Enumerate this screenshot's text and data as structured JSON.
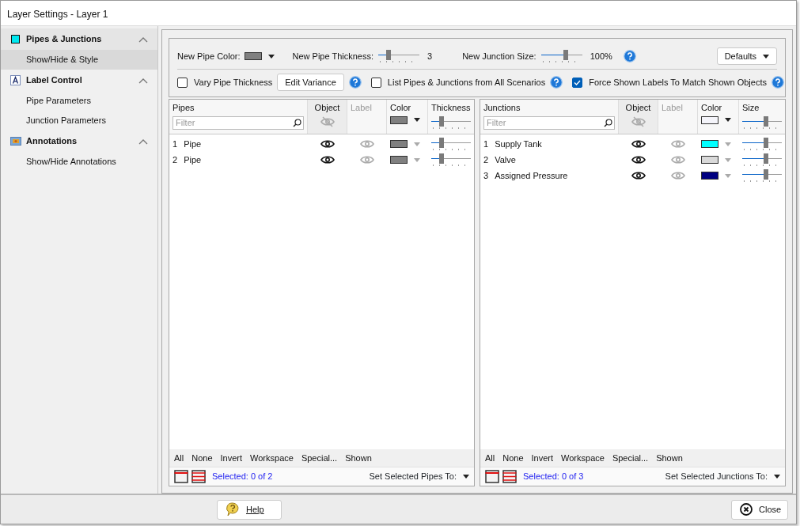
{
  "window": {
    "title": "Layer Settings - Layer 1"
  },
  "sidebar": {
    "groups": [
      {
        "label": "Pipes & Junctions",
        "expanded": true,
        "items": [
          {
            "label": "Show/Hide & Style",
            "selected": true
          }
        ]
      },
      {
        "label": "Label Control",
        "expanded": true,
        "items": [
          {
            "label": "Pipe Parameters",
            "selected": false
          },
          {
            "label": "Junction Parameters",
            "selected": false
          }
        ]
      },
      {
        "label": "Annotations",
        "expanded": true,
        "items": [
          {
            "label": "Show/Hide Annotations",
            "selected": false
          }
        ]
      }
    ]
  },
  "toolbar": {
    "pipe_color": {
      "label": "New Pipe Color:",
      "color": "#808080"
    },
    "pipe_thickness": {
      "label": "New Pipe Thickness:",
      "level": 0.25,
      "reading": "3"
    },
    "junction_size": {
      "label": "New Junction Size:",
      "level": 0.6,
      "reading": "100%"
    },
    "defaults_button": "Defaults",
    "vary_thickness": {
      "label": "Vary Pipe Thickness",
      "checked": false
    },
    "edit_variance_button": "Edit Variance",
    "list_all_scenarios": {
      "label": "List Pipes & Junctions from All Scenarios",
      "checked": false
    },
    "force_labels": {
      "label": "Force Shown Labels To Match Shown Objects",
      "checked": true
    }
  },
  "panels": [
    {
      "columns": [
        "Pipes",
        "Object",
        "Label",
        "Color",
        "Thickness"
      ],
      "filter_placeholder": "Filter",
      "header": {
        "color": "#808080",
        "level": 0.25
      },
      "rows": [
        {
          "number": "1",
          "name": "Pipe",
          "object_shown": true,
          "label_shown": false,
          "color": "#808080",
          "level": 0.25
        },
        {
          "number": "2",
          "name": "Pipe",
          "object_shown": true,
          "label_shown": false,
          "color": "#808080",
          "level": 0.25
        }
      ],
      "select_links": [
        "All",
        "None",
        "Invert",
        "Workspace",
        "Special...",
        "Shown"
      ],
      "status": "Selected: 0 of 2",
      "set_selected": "Set Selected Pipes To:"
    },
    {
      "columns": [
        "Junctions",
        "Object",
        "Label",
        "Color",
        "Size"
      ],
      "filter_placeholder": "Filter",
      "header": {
        "color": "#f4f4fa",
        "level": 0.6
      },
      "rows": [
        {
          "number": "1",
          "name": "Supply Tank",
          "object_shown": true,
          "label_shown": false,
          "color": "#00ffff",
          "level": 0.6
        },
        {
          "number": "2",
          "name": "Valve",
          "object_shown": true,
          "label_shown": false,
          "color": "#d9d9d9",
          "level": 0.6
        },
        {
          "number": "3",
          "name": "Assigned Pressure",
          "object_shown": true,
          "label_shown": false,
          "color": "#000080",
          "level": 0.6
        }
      ],
      "select_links": [
        "All",
        "None",
        "Invert",
        "Workspace",
        "Special...",
        "Shown"
      ],
      "status": "Selected: 0 of 3",
      "set_selected": "Set Selected Junctions To:"
    }
  ],
  "footer": {
    "help_button": "Help",
    "close_button": "Close"
  }
}
